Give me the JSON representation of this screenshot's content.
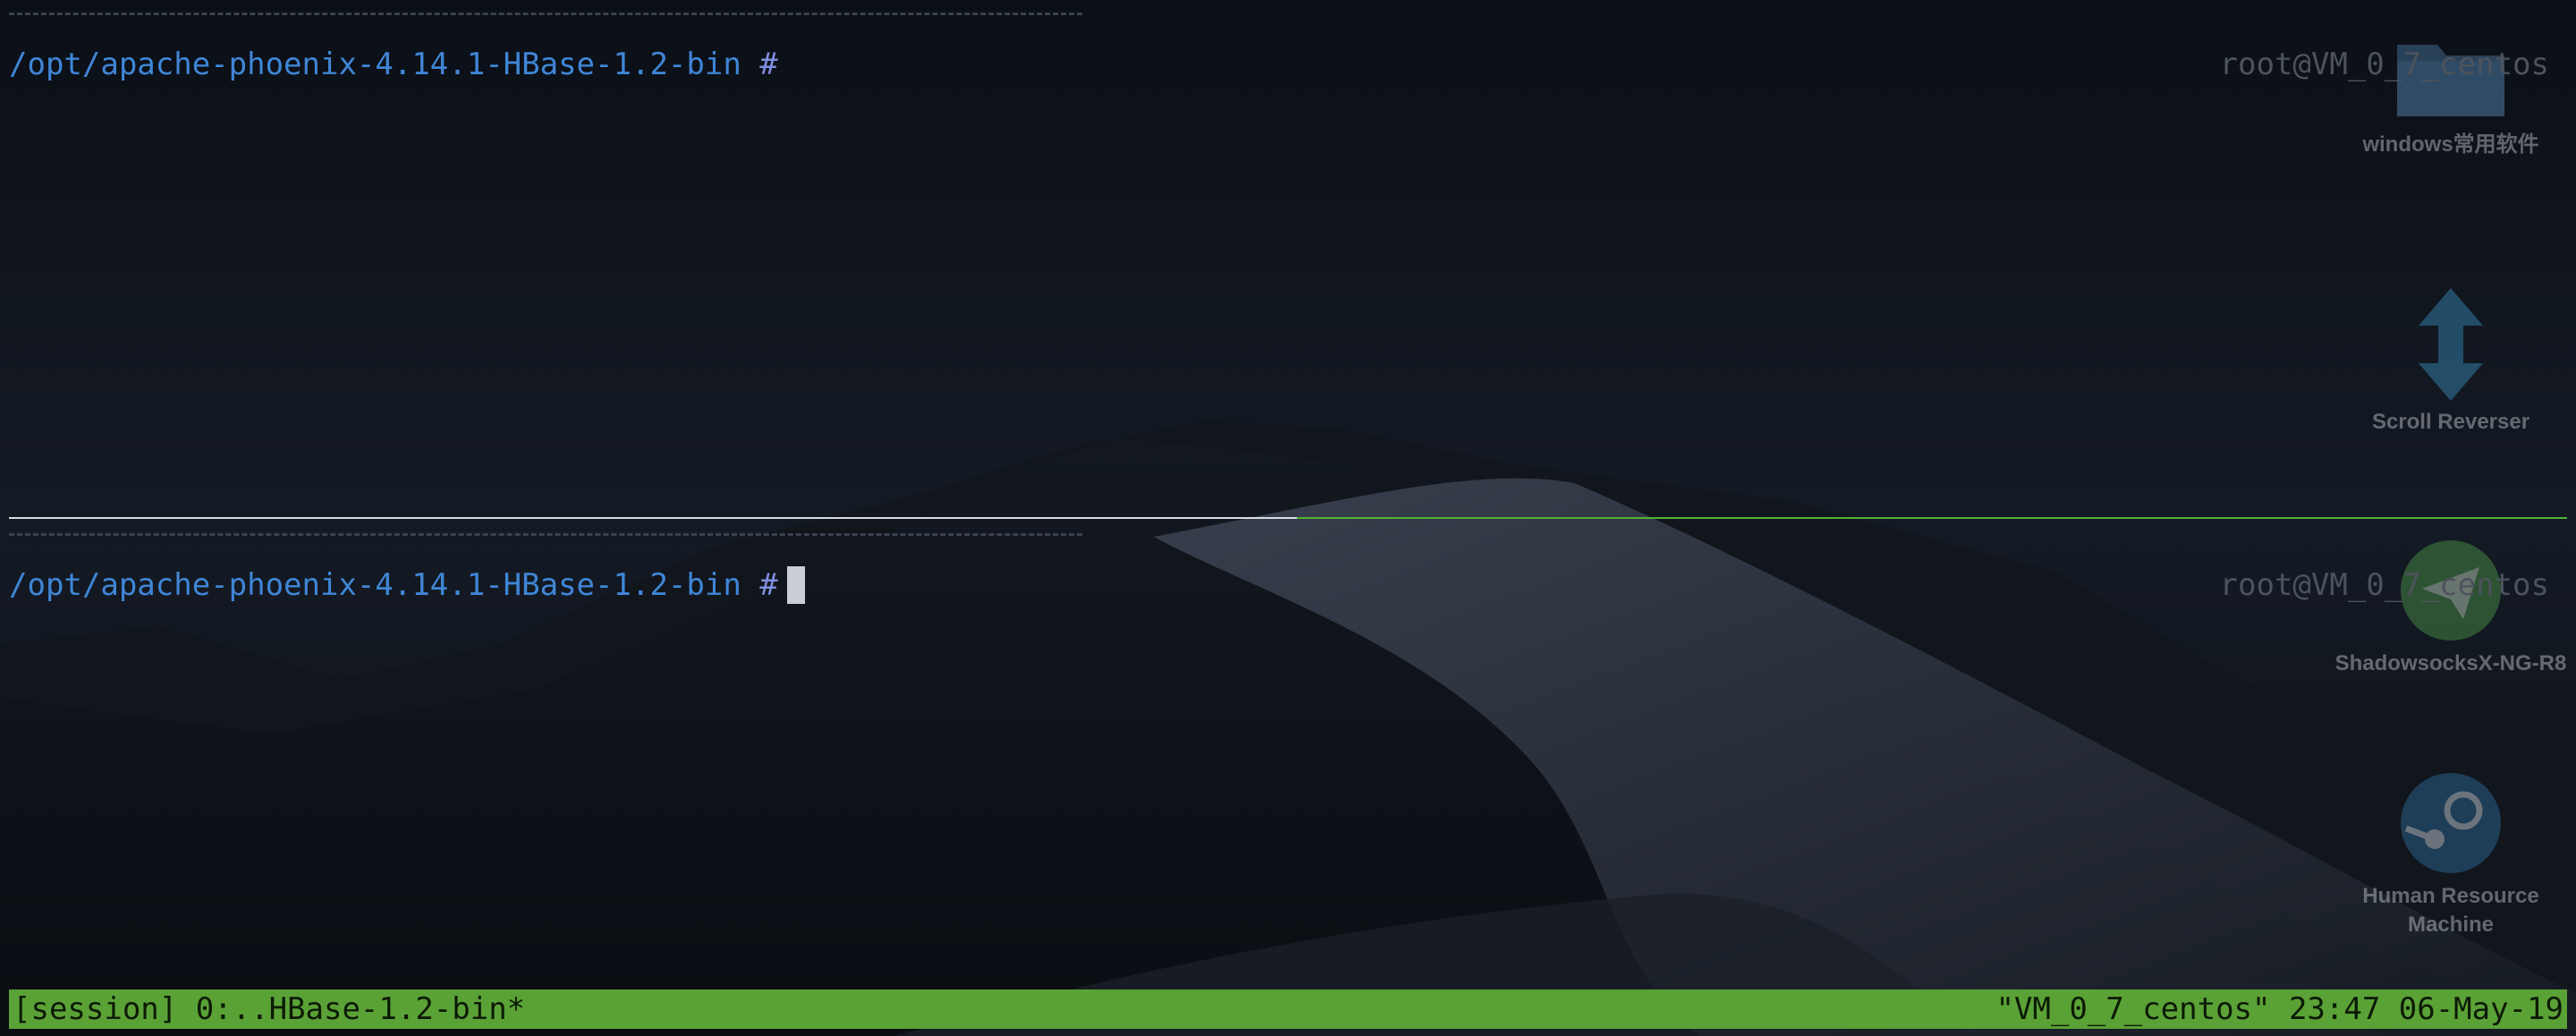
{
  "terminal": {
    "top_pane": {
      "prompt_path": "/opt/apache-phoenix-4.14.1-HBase-1.2-bin",
      "prompt_symbol": "#",
      "host": "root@VM_0_7_centos"
    },
    "bottom_pane": {
      "prompt_path": "/opt/apache-phoenix-4.14.1-HBase-1.2-bin",
      "prompt_symbol": "#",
      "host": "root@VM_0_7_centos"
    }
  },
  "status_bar": {
    "left": "[session] 0:..HBase-1.2-bin*",
    "right": "\"VM_0_7_centos\" 23:47 06-May-19",
    "color": "#5aa236"
  },
  "desktop": {
    "icons": [
      {
        "label": "windows常用软件",
        "icon": "folder-icon"
      },
      {
        "label": "Scroll Reverser",
        "icon": "scroll-reverser-icon"
      },
      {
        "label": "ShadowsocksX-NG-R8",
        "icon": "paper-plane-icon"
      },
      {
        "label": "Human Resource Machine",
        "icon": "steam-icon"
      }
    ]
  },
  "colors": {
    "prompt_path": "#3f86d6",
    "prompt_symbol": "#7f8fe0",
    "active_divider": "#4fb336",
    "background": "#0e1219"
  }
}
